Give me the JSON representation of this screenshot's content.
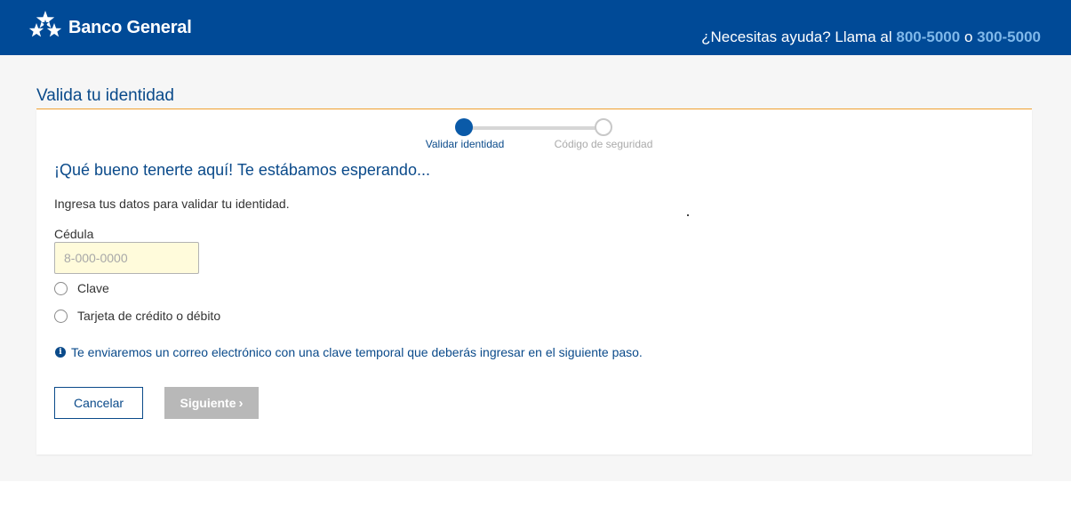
{
  "header": {
    "brand": "Banco General",
    "help_prefix": "¿Necesitas ayuda? Llama al",
    "phone_1": "800-5000",
    "help_or": "o",
    "phone_2": "300-5000"
  },
  "page": {
    "title": "Valida tu identidad"
  },
  "stepper": {
    "steps": [
      {
        "label": "Validar identidad",
        "active": true
      },
      {
        "label": "Código de seguridad",
        "active": false
      }
    ]
  },
  "form": {
    "welcome": "¡Qué bueno tenerte aquí! Te estábamos esperando...",
    "instructions": "Ingresa tus datos para validar tu identidad.",
    "cedula_label": "Cédula",
    "cedula_placeholder": "8-000-0000",
    "cedula_value": "",
    "options": [
      {
        "label": "Clave",
        "selected": false
      },
      {
        "label": "Tarjeta de crédito o débito",
        "selected": false
      }
    ],
    "info_icon": "info-circle-icon",
    "info_text": "Te enviaremos un correo electrónico con una clave temporal que deberás ingresar en el siguiente paso.",
    "cancel_label": "Cancelar",
    "next_label": "Siguiente",
    "next_icon": "chevron-right-icon",
    "next_disabled": true
  },
  "colors": {
    "brand_blue": "#004a97",
    "accent_orange": "#f0a030",
    "link_blue": "#7fb8ea",
    "disabled_gray": "#b8b8b8"
  }
}
